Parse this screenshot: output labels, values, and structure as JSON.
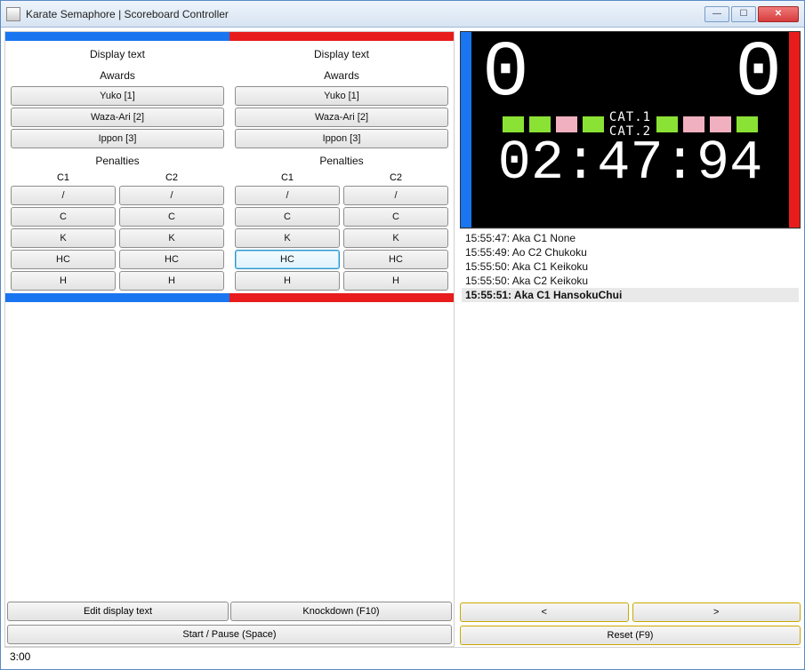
{
  "window": {
    "title": "Karate Semaphore | Scoreboard Controller"
  },
  "left": {
    "blue": {
      "display_text": "Display text",
      "awards_label": "Awards",
      "awards": [
        "Yuko [1]",
        "Waza-Ari [2]",
        "Ippon [3]"
      ],
      "penalties_label": "Penalties",
      "c1": "C1",
      "c2": "C2",
      "penalties": [
        "/",
        "C",
        "K",
        "HC",
        "H"
      ]
    },
    "red": {
      "display_text": "Display text",
      "awards_label": "Awards",
      "awards": [
        "Yuko [1]",
        "Waza-Ari [2]",
        "Ippon [3]"
      ],
      "penalties_label": "Penalties",
      "c1": "C1",
      "c2": "C2",
      "penalties": [
        "/",
        "C",
        "K",
        "HC",
        "H"
      ]
    },
    "edit_display": "Edit display text",
    "knockdown": "Knockdown (F10)",
    "startpause": "Start / Pause (Space)"
  },
  "right": {
    "score_blue": "0",
    "score_red": "0",
    "cat1": "CAT.1",
    "cat2": "CAT.2",
    "timer": "02:47:94",
    "log": [
      "15:55:47: Aka C1 None",
      "15:55:49: Ao C2 Chukoku",
      "15:55:50: Aka C1 Keikoku",
      "15:55:50: Aka C2 Keikoku",
      "15:55:51: Aka C1 HansokuChui"
    ],
    "prev": "<",
    "next": ">",
    "reset": "Reset (F9)"
  },
  "status": "3:00"
}
